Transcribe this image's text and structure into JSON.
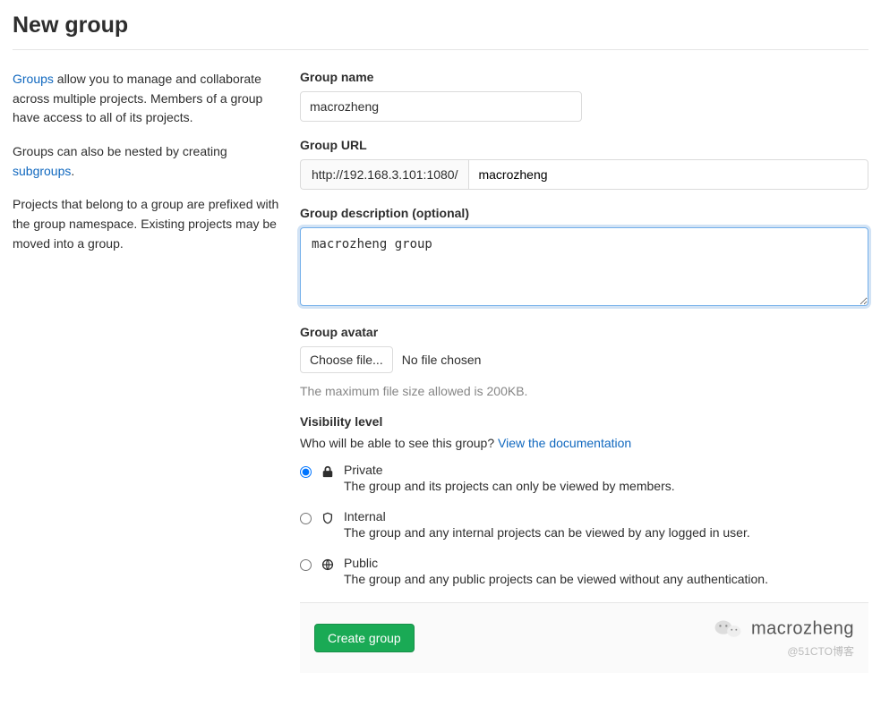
{
  "page_title": "New group",
  "sidebar": {
    "p1_link": "Groups",
    "p1_rest": " allow you to manage and collaborate across multiple projects. Members of a group have access to all of its projects.",
    "p2_prefix": "Groups can also be nested by creating ",
    "p2_link": "subgroups",
    "p2_suffix": ".",
    "p3": "Projects that belong to a group are prefixed with the group namespace. Existing projects may be moved into a group."
  },
  "form": {
    "group_name_label": "Group name",
    "group_name_value": "macrozheng",
    "group_url_label": "Group URL",
    "group_url_prefix": "http://192.168.3.101:1080/",
    "group_url_value": "macrozheng",
    "group_description_label": "Group description (optional)",
    "group_description_value": "macrozheng group",
    "group_avatar_label": "Group avatar",
    "choose_file_label": "Choose file...",
    "no_file_chosen": "No file chosen",
    "file_hint": "The maximum file size allowed is 200KB.",
    "visibility_label": "Visibility level",
    "visibility_help_prefix": "Who will be able to see this group? ",
    "visibility_help_link": "View the documentation",
    "visibility_options": [
      {
        "key": "private",
        "title": "Private",
        "desc": "The group and its projects can only be viewed by members.",
        "checked": true
      },
      {
        "key": "internal",
        "title": "Internal",
        "desc": "The group and any internal projects can be viewed by any logged in user.",
        "checked": false
      },
      {
        "key": "public",
        "title": "Public",
        "desc": "The group and any public projects can be viewed without any authentication.",
        "checked": false
      }
    ],
    "submit_label": "Create group"
  },
  "watermark": {
    "name": "macrozheng",
    "source": "@51CTO博客"
  }
}
